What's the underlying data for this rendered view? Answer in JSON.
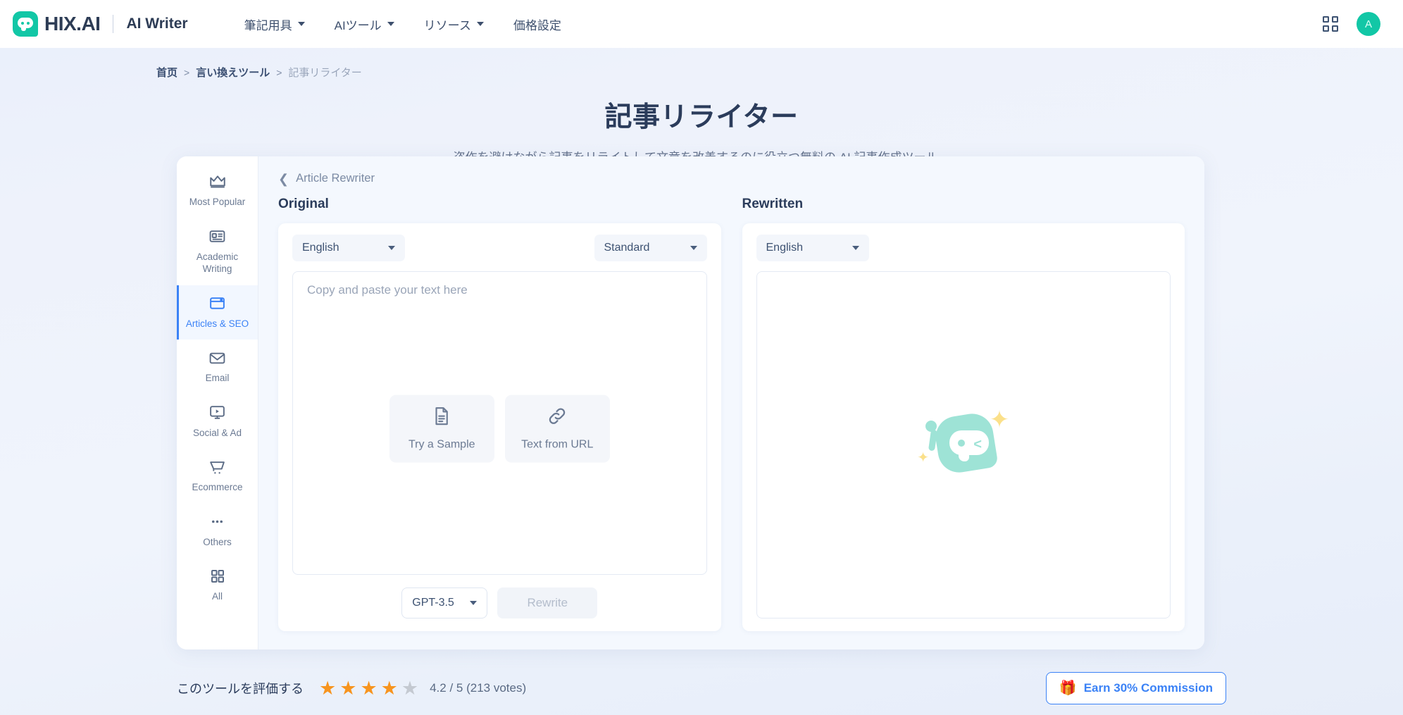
{
  "topbar": {
    "logo_word": "HIX.AI",
    "logo_sub": "AI Writer",
    "logo_mark_name": "hix-chat-bubble-logo",
    "nav": [
      {
        "label": "筆記用具",
        "has_caret": true
      },
      {
        "label": "AIツール",
        "has_caret": true
      },
      {
        "label": "リソース",
        "has_caret": true
      },
      {
        "label": "価格設定",
        "has_caret": false
      }
    ],
    "apps_icon": "grid-apps-icon",
    "avatar_initial": "A",
    "avatar_color": "#12C7A6"
  },
  "breadcrumb": {
    "home": "首页",
    "sep": ">",
    "parent": "言い換えツール",
    "current": "記事リライター"
  },
  "hero": {
    "title": "記事リライター",
    "subtitle": "盗作を避けながら記事をリライトして文章を改善するのに役立つ無料の AI 記事作成ツール。"
  },
  "sidebar": {
    "items": [
      {
        "label": "Most Popular",
        "icon": "crown-icon",
        "active": false
      },
      {
        "label": "Academic Writing",
        "icon": "id-card-icon",
        "active": false
      },
      {
        "label": "Articles & SEO",
        "icon": "browser-window-icon",
        "active": true
      },
      {
        "label": "Email",
        "icon": "envelope-icon",
        "active": false
      },
      {
        "label": "Social & Ad",
        "icon": "monitor-play-icon",
        "active": false
      },
      {
        "label": "Ecommerce",
        "icon": "shopping-cart-icon",
        "active": false
      },
      {
        "label": "Others",
        "icon": "ellipsis-icon",
        "active": false
      },
      {
        "label": "All",
        "icon": "grid-squares-icon",
        "active": false
      }
    ],
    "active_color": "#3b82f6"
  },
  "workspace": {
    "back_label": "Article Rewriter",
    "back_icon": "chevron-left-icon",
    "original": {
      "title": "Original",
      "language": "English",
      "mode": "Standard",
      "placeholder": "Copy and paste your text here",
      "actions": [
        {
          "label": "Try a Sample",
          "icon": "document-text-icon"
        },
        {
          "label": "Text from URL",
          "icon": "link-chain-icon"
        }
      ],
      "model": "GPT-3.5",
      "rewrite_button": "Rewrite",
      "rewrite_enabled": false
    },
    "rewritten": {
      "title": "Rewritten",
      "language": "English",
      "mascot": "hix-mascot-illustration",
      "mascot_color": "#9EE3D6",
      "sparkle_color": "#FBE08A"
    }
  },
  "bottom": {
    "rate_label": "このツールを評価する",
    "stars_filled": 4,
    "stars_total": 5,
    "rating_text": "4.2 / 5 (213 votes)",
    "star_color": "#F7941E",
    "star_empty_color": "#C4C9D1",
    "commission_label": "Earn 30% Commission",
    "commission_icon": "gift-party-icon",
    "commission_color": "#3b82f6"
  }
}
